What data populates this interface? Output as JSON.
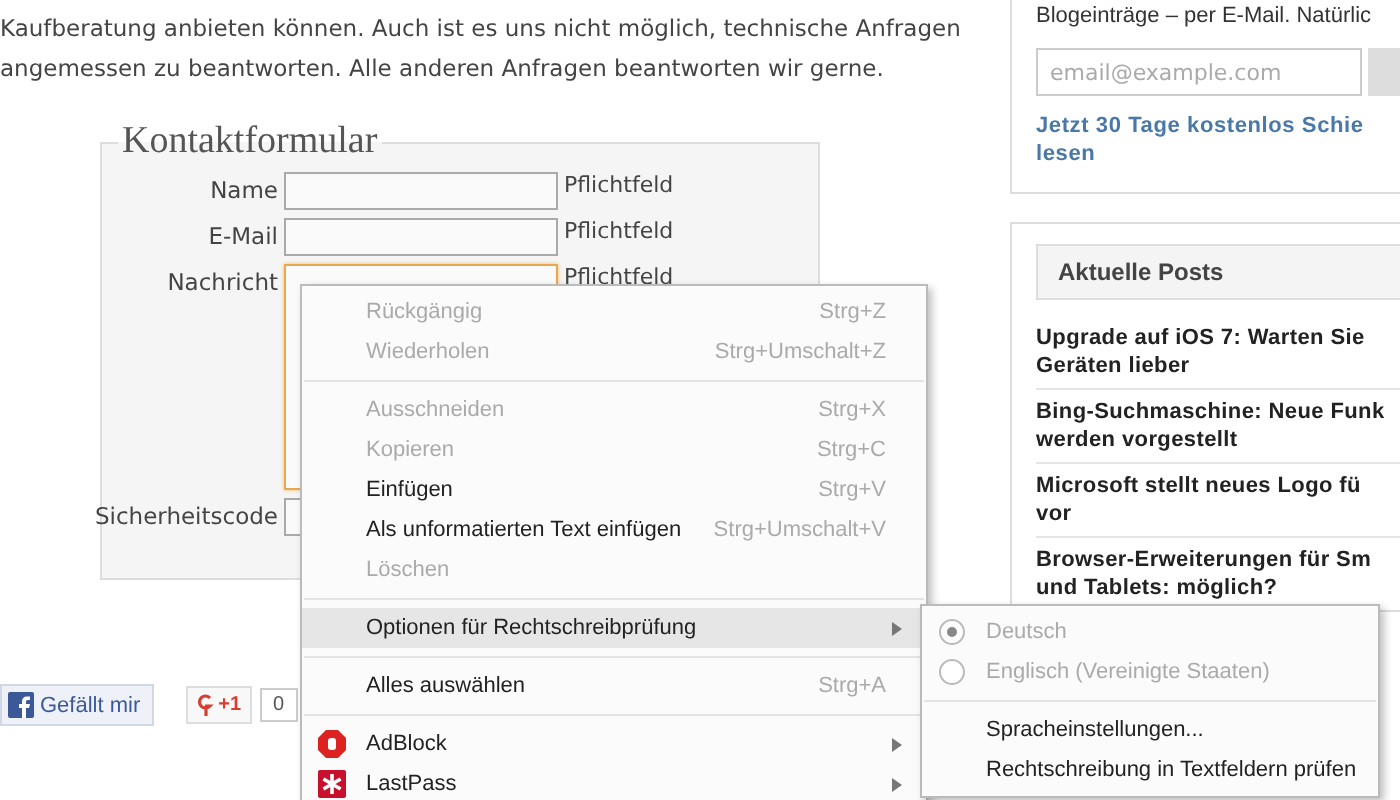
{
  "article": {
    "lines": [
      "Kaufberatung anbieten können. Auch ist es uns nicht möglich, technische Anfragen",
      "angemessen zu beantworten. Alle anderen Anfragen beantworten wir gerne."
    ]
  },
  "form": {
    "legend": "Kontaktformular",
    "fields": [
      {
        "kind": "input",
        "label": "Name",
        "hint": "Pflichtfeld",
        "focused": false
      },
      {
        "kind": "input",
        "label": "E-Mail",
        "hint": "Pflichtfeld",
        "focused": false
      },
      {
        "kind": "textarea",
        "label": "Nachricht",
        "hint": "Pflichtfeld",
        "focused": true
      },
      {
        "kind": "input",
        "label": "Sicherheitscode",
        "focused": false
      }
    ]
  },
  "social": {
    "like": "Gefällt mir",
    "plusone": "+1",
    "count": "0"
  },
  "sidebar": {
    "newsletter": {
      "text": "Blogeinträge – per E-Mail. Natürlic",
      "placeholder": "email@example.com",
      "link": [
        "Jetzt 30 Tage kostenlos Schie",
        "lesen"
      ]
    },
    "posts": {
      "title": "Aktuelle Posts",
      "items": [
        [
          "Upgrade auf iOS 7: Warten Sie",
          "Geräten lieber"
        ],
        [
          "Bing-Suchmaschine: Neue Funk",
          "werden vorgestellt"
        ],
        [
          "Microsoft stellt neues Logo fü",
          "vor"
        ],
        [
          "Browser-Erweiterungen für Sm",
          "und Tablets: möglich?"
        ]
      ]
    }
  },
  "context_menu": {
    "items": [
      {
        "kind": "command",
        "label": "Rückgängig",
        "shortcut": "Strg+Z",
        "disabled": true
      },
      {
        "kind": "command",
        "label": "Wiederholen",
        "shortcut": "Strg+Umschalt+Z",
        "disabled": true
      },
      {
        "kind": "separator"
      },
      {
        "kind": "command",
        "label": "Ausschneiden",
        "shortcut": "Strg+X",
        "disabled": true
      },
      {
        "kind": "command",
        "label": "Kopieren",
        "shortcut": "Strg+C",
        "disabled": true
      },
      {
        "kind": "command",
        "label": "Einfügen",
        "shortcut": "Strg+V",
        "disabled": false
      },
      {
        "kind": "command",
        "label": "Als unformatierten Text einfügen",
        "shortcut": "Strg+Umschalt+V",
        "disabled": false
      },
      {
        "kind": "command",
        "label": "Löschen",
        "disabled": true
      },
      {
        "kind": "separator"
      },
      {
        "kind": "submenu",
        "label": "Optionen für Rechtschreibprüfung",
        "highlighted": true
      },
      {
        "kind": "separator"
      },
      {
        "kind": "command",
        "label": "Alles auswählen",
        "shortcut": "Strg+A",
        "disabled": false
      },
      {
        "kind": "separator"
      },
      {
        "kind": "extension",
        "label": "AdBlock"
      },
      {
        "kind": "extension",
        "label": "LastPass"
      }
    ]
  },
  "spelling_menu": {
    "items": [
      {
        "kind": "radio",
        "label": "Deutsch",
        "selected": true,
        "disabled": true
      },
      {
        "kind": "radio",
        "label": "Englisch (Vereinigte Staaten)",
        "selected": false,
        "disabled": true
      },
      {
        "kind": "separator"
      },
      {
        "kind": "command",
        "label": "Spracheinstellungen...",
        "disabled": false
      },
      {
        "kind": "command",
        "label": "Rechtschreibung in Textfeldern prüfen",
        "disabled": false
      }
    ]
  }
}
